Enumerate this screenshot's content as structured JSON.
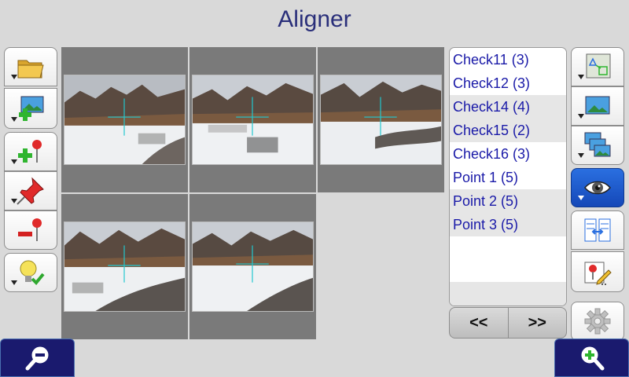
{
  "app": {
    "title": "Aligner"
  },
  "left_toolbar": [
    {
      "name": "open-folder",
      "icon": "folder-icon"
    },
    {
      "name": "add-image",
      "icon": "add-image-icon"
    },
    {
      "name": "add-point",
      "icon": "add-point-icon"
    },
    {
      "name": "pin-point",
      "icon": "pushpin-icon"
    },
    {
      "name": "remove-point",
      "icon": "remove-point-icon"
    },
    {
      "name": "hint",
      "icon": "lightbulb-check-icon"
    }
  ],
  "right_toolbar": [
    {
      "name": "align",
      "icon": "align-icon"
    },
    {
      "name": "image",
      "icon": "image-icon"
    },
    {
      "name": "stack",
      "icon": "stack-images-icon"
    },
    {
      "name": "view",
      "icon": "eye-icon",
      "active": true
    },
    {
      "name": "compare",
      "icon": "compare-icon"
    },
    {
      "name": "edit-point",
      "icon": "edit-point-icon"
    },
    {
      "name": "settings",
      "icon": "gear-icon"
    }
  ],
  "points_list": [
    {
      "label": "Check11 (3)"
    },
    {
      "label": "Check12 (3)"
    },
    {
      "label": "Check14 (4)"
    },
    {
      "label": "Check15 (2)"
    },
    {
      "label": "Check16 (3)"
    },
    {
      "label": "Point 1 (5)"
    },
    {
      "label": "Point 2 (5)"
    },
    {
      "label": "Point 3 (5)"
    }
  ],
  "pager": {
    "prev_label": "<<",
    "next_label": ">>"
  },
  "zoom": {
    "out_icon": "zoom-out-icon",
    "in_icon": "zoom-in-icon"
  },
  "thumbnails": [
    "photo-1",
    "photo-2",
    "photo-3",
    "photo-4",
    "photo-5"
  ],
  "colors": {
    "title": "#2a2f7a",
    "list_text": "#1a1aa8",
    "crosshair": "#20c8d0",
    "zoom_bg": "#1a1a6e",
    "active_btn": "#1e5cd0"
  }
}
